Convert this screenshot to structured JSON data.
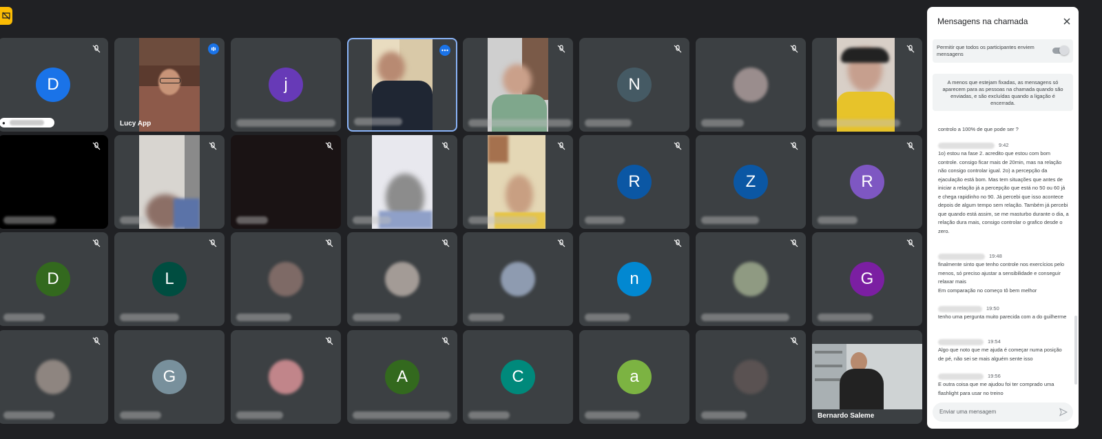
{
  "participants": {
    "lucy": "Lucy App",
    "bernardo": "Bernardo Saleme",
    "avatars": {
      "t1": {
        "letter": "D",
        "color": "#1a73e8"
      },
      "t3": {
        "letter": "j",
        "color": "#673ab7"
      },
      "t6": {
        "letter": "N",
        "color": "#455a64"
      },
      "t14": {
        "letter": "R",
        "color": "#0b57a4"
      },
      "t15": {
        "letter": "Z",
        "color": "#0b57a4"
      },
      "t16": {
        "letter": "R",
        "color": "#7e57c2"
      },
      "t17": {
        "letter": "D",
        "color": "#33691e"
      },
      "t18": {
        "letter": "L",
        "color": "#004d40"
      },
      "t22": {
        "letter": "n",
        "color": "#0288d1"
      },
      "t24": {
        "letter": "G",
        "color": "#7b1fa2"
      },
      "t26": {
        "letter": "G",
        "color": "#78909c"
      },
      "t28": {
        "letter": "A",
        "color": "#33691e"
      },
      "t29": {
        "letter": "C",
        "color": "#00897b"
      },
      "t30": {
        "letter": "a",
        "color": "#7cb342"
      }
    }
  },
  "chat": {
    "title": "Mensagens na chamada",
    "allow_label": "Permitir que todos os participantes enviem mensagens",
    "allow_enabled": true,
    "info": "A menos que estejam fixadas, as mensagens só aparecem para as pessoas na chamada quando são enviadas, e são excluídas quando a ligação é encerrada.",
    "messages": [
      {
        "time": "",
        "text": "controlo a 100% de que pode ser ?"
      },
      {
        "time": "9:42",
        "text": "1o) estou na fase 2. acredito que estou com bom controle. consigo ficar mais de 20min, mas na relação não consigo controlar igual. 2o) a percepção da ejaculação está bom. Mas tem situações que antes de iniciar a relação já a percepção que está no 50 ou 60 já e chega rapidinho no 90. Já percebi que isso acontece depois de algum tempo sem relação. Também já percebi que quando está assim, se me masturbo durante o dia, a relação dura mais, consigo controlar o grafico desde o zero."
      },
      {
        "time": "19:48",
        "text": "finalmente sinto que tenho controle nos exercícios pelo menos, só preciso ajustar a sensibilidade e conseguir relaxar mais"
      },
      {
        "time": "",
        "text": "Em comparação no começo tô bem melhor"
      },
      {
        "time": "19:50",
        "text": "tenho uma pergunta muito parecida com a do guilherme"
      },
      {
        "time": "19:54",
        "text": "Algo que noto que me ajuda é começar numa posição de pé, não sei se mais alguém sente isso"
      },
      {
        "time": "19:56",
        "text": "E outra coisa que me ajudou foi ter comprado uma flashlight para usar no treino"
      }
    ],
    "input_placeholder": "Enviar uma mensagem"
  },
  "icons": {
    "mute": "mic-off-icon",
    "close": "close-icon",
    "send": "send-icon",
    "speaking": "speaking-icon",
    "more": "more-options-icon",
    "badge": "presentation-off-icon"
  }
}
